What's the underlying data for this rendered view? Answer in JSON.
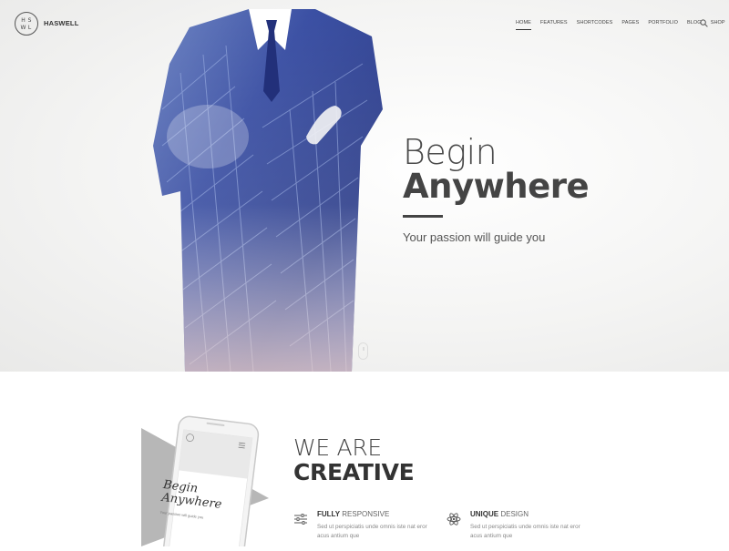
{
  "logo": {
    "letters": [
      "H",
      "S",
      "W",
      "L"
    ],
    "name": "HASWELL"
  },
  "nav": [
    "HOME",
    "FEATURES",
    "SHORTCODES",
    "PAGES",
    "PORTFOLIO",
    "BLOG",
    "SHOP"
  ],
  "hero": {
    "line1": "Begin",
    "line2": "Anywhere",
    "subtitle": "Your passion will guide you"
  },
  "phone": {
    "line1": "Begin",
    "line2": "Anywhere",
    "subtitle": "Your passion will guide you"
  },
  "section": {
    "line1": "WE ARE",
    "line2": "CREATIVE"
  },
  "features": [
    {
      "bold": "FULLY",
      "light": " RESPONSIVE",
      "icon": "sliders-icon",
      "desc": "Sed ut perspiciatis unde omnis iste nat eror acus antium que"
    },
    {
      "bold": "UNIQUE",
      "light": " DESIGN",
      "icon": "atom-icon",
      "desc": "Sed ut perspiciatis unde omnis iste nat eror acus antium que"
    }
  ],
  "colors": {
    "suit": "#2c3d8a",
    "accent": "#444444",
    "triangle": "#b0b0b0"
  }
}
